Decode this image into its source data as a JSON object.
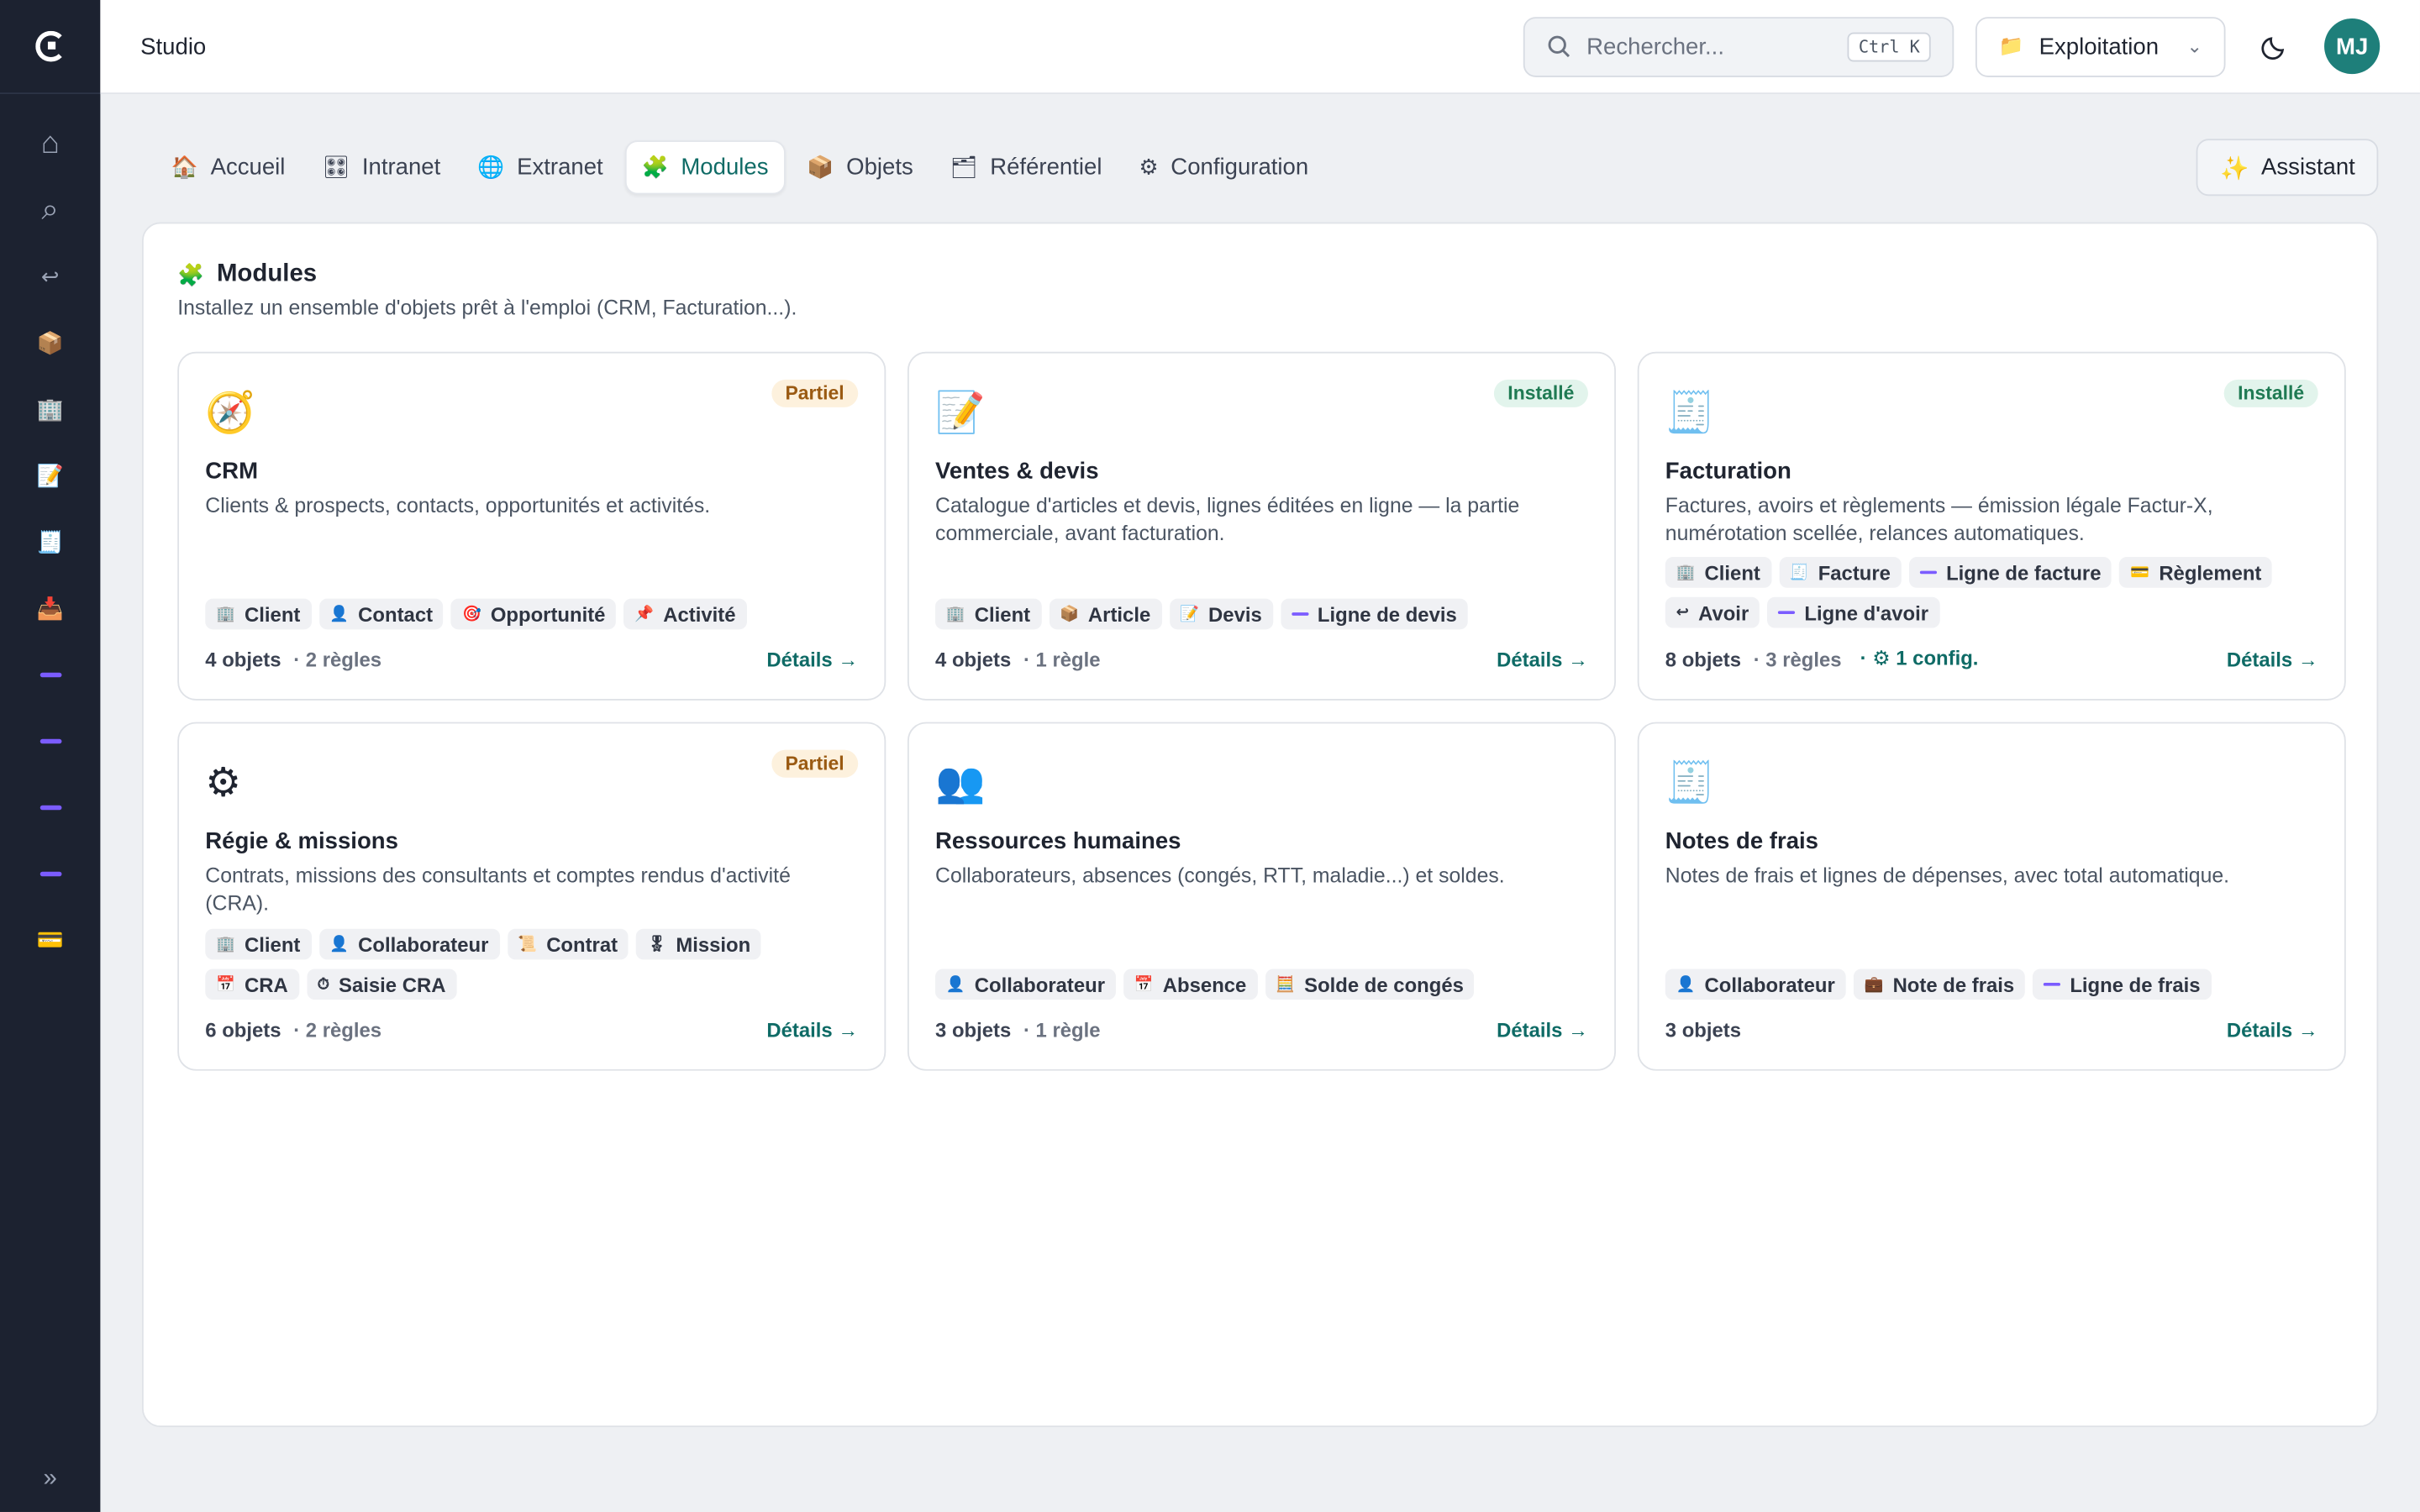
{
  "app": {
    "title": "Studio"
  },
  "search": {
    "placeholder": "Rechercher...",
    "shortcut": "Ctrl K"
  },
  "environment": {
    "label": "Exploitation",
    "icon": "folder-icon"
  },
  "user": {
    "initials": "MJ",
    "avatar_color": "#1e7f7a"
  },
  "sidebar": {
    "items": [
      {
        "name": "home-icon",
        "glyph": "⌂"
      },
      {
        "name": "search-icon",
        "glyph": "⌕"
      },
      {
        "name": "return-icon",
        "glyph": "↩"
      },
      {
        "name": "package-icon",
        "glyph": "📦"
      },
      {
        "name": "building-icon",
        "glyph": "🏢"
      },
      {
        "name": "document-icon",
        "glyph": "📝"
      },
      {
        "name": "receipt-icon",
        "glyph": "🧾"
      },
      {
        "name": "inbox-icon",
        "glyph": "📥"
      },
      {
        "name": "dash-icon"
      },
      {
        "name": "dash-icon"
      },
      {
        "name": "dash-icon"
      },
      {
        "name": "dash-icon"
      },
      {
        "name": "card-icon",
        "glyph": "💳"
      }
    ],
    "expand_glyph": "»"
  },
  "tabs": [
    {
      "label": "Accueil",
      "icon": "🏠",
      "active": false
    },
    {
      "label": "Intranet",
      "icon": "🎛",
      "active": false
    },
    {
      "label": "Extranet",
      "icon": "🌐",
      "active": false
    },
    {
      "label": "Modules",
      "icon": "🧩",
      "active": true
    },
    {
      "label": "Objets",
      "icon": "📦",
      "active": false
    },
    {
      "label": "Référentiel",
      "icon": "🗂",
      "active": false
    },
    {
      "label": "Configuration",
      "icon": "⚙",
      "active": false
    }
  ],
  "assistant": {
    "label": "Assistant",
    "icon": "✨"
  },
  "panel": {
    "title": "Modules",
    "icon": "🧩",
    "subtitle": "Installez un ensemble d'objets prêt à l'emploi (CRM, Facturation...)."
  },
  "modules": [
    {
      "name": "CRM",
      "icon": "🧭",
      "status": "Partiel",
      "status_kind": "partial",
      "description": "Clients & prospects, contacts, opportunités et activités.",
      "objects": [
        {
          "label": "Client",
          "icon": "🏢"
        },
        {
          "label": "Contact",
          "icon": "👤"
        },
        {
          "label": "Opportunité",
          "icon": "🎯"
        },
        {
          "label": "Activité",
          "icon": "📌"
        }
      ],
      "count_objects": "4 objets",
      "count_rules": "· 2 règles",
      "config": "",
      "details": "Détails →"
    },
    {
      "name": "Ventes & devis",
      "icon": "📝",
      "status": "Installé",
      "status_kind": "installed",
      "description": "Catalogue d'articles et devis, lignes éditées en ligne — la partie commerciale, avant facturation.",
      "objects": [
        {
          "label": "Client",
          "icon": "🏢"
        },
        {
          "label": "Article",
          "icon": "📦"
        },
        {
          "label": "Devis",
          "icon": "📝"
        },
        {
          "label": "Ligne de devis",
          "icon": "dash"
        }
      ],
      "count_objects": "4 objets",
      "count_rules": "· 1 règle",
      "config": "",
      "details": "Détails →"
    },
    {
      "name": "Facturation",
      "icon": "🧾",
      "status": "Installé",
      "status_kind": "installed",
      "description": "Factures, avoirs et règlements — émission légale Factur-X, numérotation scellée, relances automatiques.",
      "objects": [
        {
          "label": "Client",
          "icon": "🏢"
        },
        {
          "label": "Facture",
          "icon": "🧾"
        },
        {
          "label": "Ligne de facture",
          "icon": "dash"
        },
        {
          "label": "Règlement",
          "icon": "💳"
        },
        {
          "label": "Avoir",
          "icon": "↩"
        },
        {
          "label": "Ligne d'avoir",
          "icon": "dash"
        }
      ],
      "count_objects": "8 objets",
      "count_rules": "· 3 règles",
      "config": "· ⚙ 1 config.",
      "details": "Détails →"
    },
    {
      "name": "Régie & missions",
      "icon": "⚙",
      "status": "Partiel",
      "status_kind": "partial",
      "description": "Contrats, missions des consultants et comptes rendus d'activité (CRA).",
      "objects": [
        {
          "label": "Client",
          "icon": "🏢"
        },
        {
          "label": "Collaborateur",
          "icon": "👤"
        },
        {
          "label": "Contrat",
          "icon": "📜"
        },
        {
          "label": "Mission",
          "icon": "🎖"
        },
        {
          "label": "CRA",
          "icon": "📅"
        },
        {
          "label": "Saisie CRA",
          "icon": "⏱"
        }
      ],
      "count_objects": "6 objets",
      "count_rules": "· 2 règles",
      "config": "",
      "details": "Détails →"
    },
    {
      "name": "Ressources humaines",
      "icon": "👥",
      "status": "",
      "status_kind": "",
      "description": "Collaborateurs, absences (congés, RTT, maladie...) et soldes.",
      "objects": [
        {
          "label": "Collaborateur",
          "icon": "👤"
        },
        {
          "label": "Absence",
          "icon": "📅"
        },
        {
          "label": "Solde de congés",
          "icon": "🧮"
        }
      ],
      "count_objects": "3 objets",
      "count_rules": "· 1 règle",
      "config": "",
      "details": "Détails →"
    },
    {
      "name": "Notes de frais",
      "icon": "🧾",
      "status": "",
      "status_kind": "",
      "description": "Notes de frais et lignes de dépenses, avec total automatique.",
      "objects": [
        {
          "label": "Collaborateur",
          "icon": "👤"
        },
        {
          "label": "Note de frais",
          "icon": "💼"
        },
        {
          "label": "Ligne de frais",
          "icon": "dash"
        }
      ],
      "count_objects": "3 objets",
      "count_rules": "",
      "config": "",
      "details": "Détails →"
    }
  ]
}
